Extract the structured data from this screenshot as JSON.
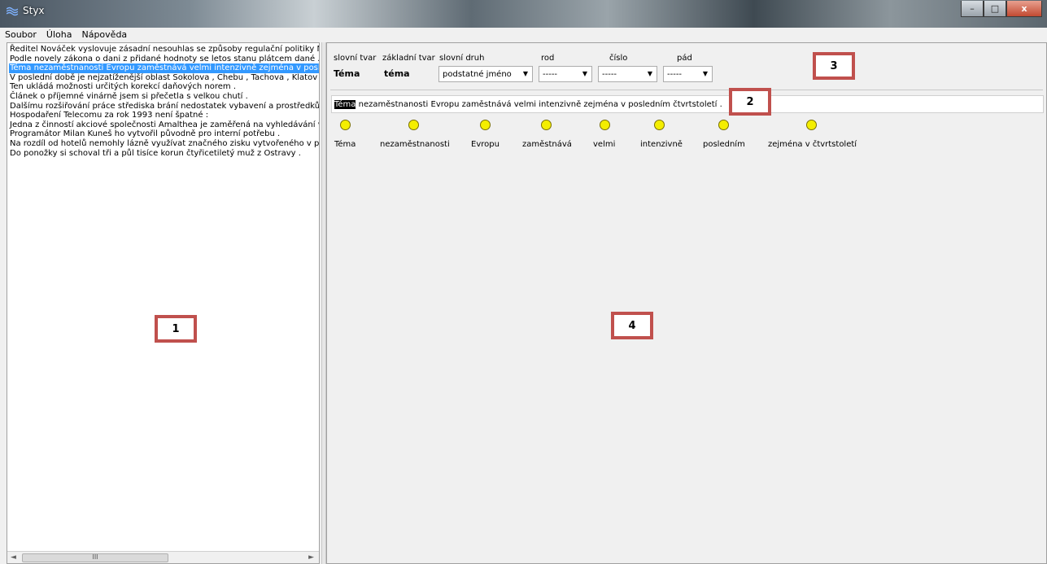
{
  "window": {
    "title": "Styx",
    "buttons": {
      "minimize": "–",
      "maximize": "□",
      "close": "x"
    }
  },
  "menu": [
    "Soubor",
    "Úloha",
    "Nápověda"
  ],
  "sentences": [
    "Ředitel Nováček vyslovuje zásadní nesouhlas se způsoby regulační politiky M",
    "Podle novely zákona o dani z přidané hodnoty se letos stanu plátcem dané .",
    "Téma nezaměstnanosti Evropu zaměstnává velmi intenzivně zejména v posle",
    "V poslední době je nejzatíženější oblast Sokolova , Chebu , Tachova , Klatov ,",
    "Ten ukládá možnosti určitých korekcí daňových norem .",
    "Článek o příjemné vinárně jsem si přečetla s velkou chutí .",
    "Dalšímu rozšiřování práce střediska brání nedostatek vybavení a prostředků .",
    "Hospodaření Telecomu za rok 1993 není špatné :",
    "Jedna z činností akciové společnosti Amalthea je zaměřená na vyhledávání vl",
    "Programátor Milan Kuneš ho vytvořil původně pro interní potřebu .",
    "Na rozdíl od hotelů nemohly lázně využívat značného zisku vytvořeného v př",
    "Do ponožky si schoval tři a půl tisíce korun čtyřicetiletý muž z Ostravy ."
  ],
  "selected_index": 2,
  "scrollbar": {
    "thumb_label": "III",
    "left_arrow": "◄",
    "right_arrow": "►"
  },
  "morph": {
    "headers": {
      "slovni_tvar": "slovní tvar",
      "zakladni_tvar": "základní tvar",
      "slovni_druh": "slovní druh",
      "rod": "rod",
      "cislo": "číslo",
      "pad": "pád"
    },
    "slovni_tvar": "Téma",
    "zakladni_tvar": "téma",
    "slovni_druh": "podstatné jméno",
    "rod": "-----",
    "cislo": "-----",
    "pad": "-----"
  },
  "sentence": {
    "highlighted": "Téma",
    "rest": " nezaměstnanosti Evropu zaměstnává velmi intenzivně zejména v posledním čtvrtstoletí ."
  },
  "nodes": [
    "Téma",
    "nezaměstnanosti",
    "Evropu",
    "zaměstnává",
    "velmi",
    "intenzivně",
    "posledním",
    "zejména v čtvrtstoletí"
  ],
  "callouts": [
    "1",
    "2",
    "3",
    "4"
  ],
  "colors": {
    "selection": "#3399ff",
    "node_fill": "#f4ee00",
    "callout_border": "#c0504d"
  }
}
